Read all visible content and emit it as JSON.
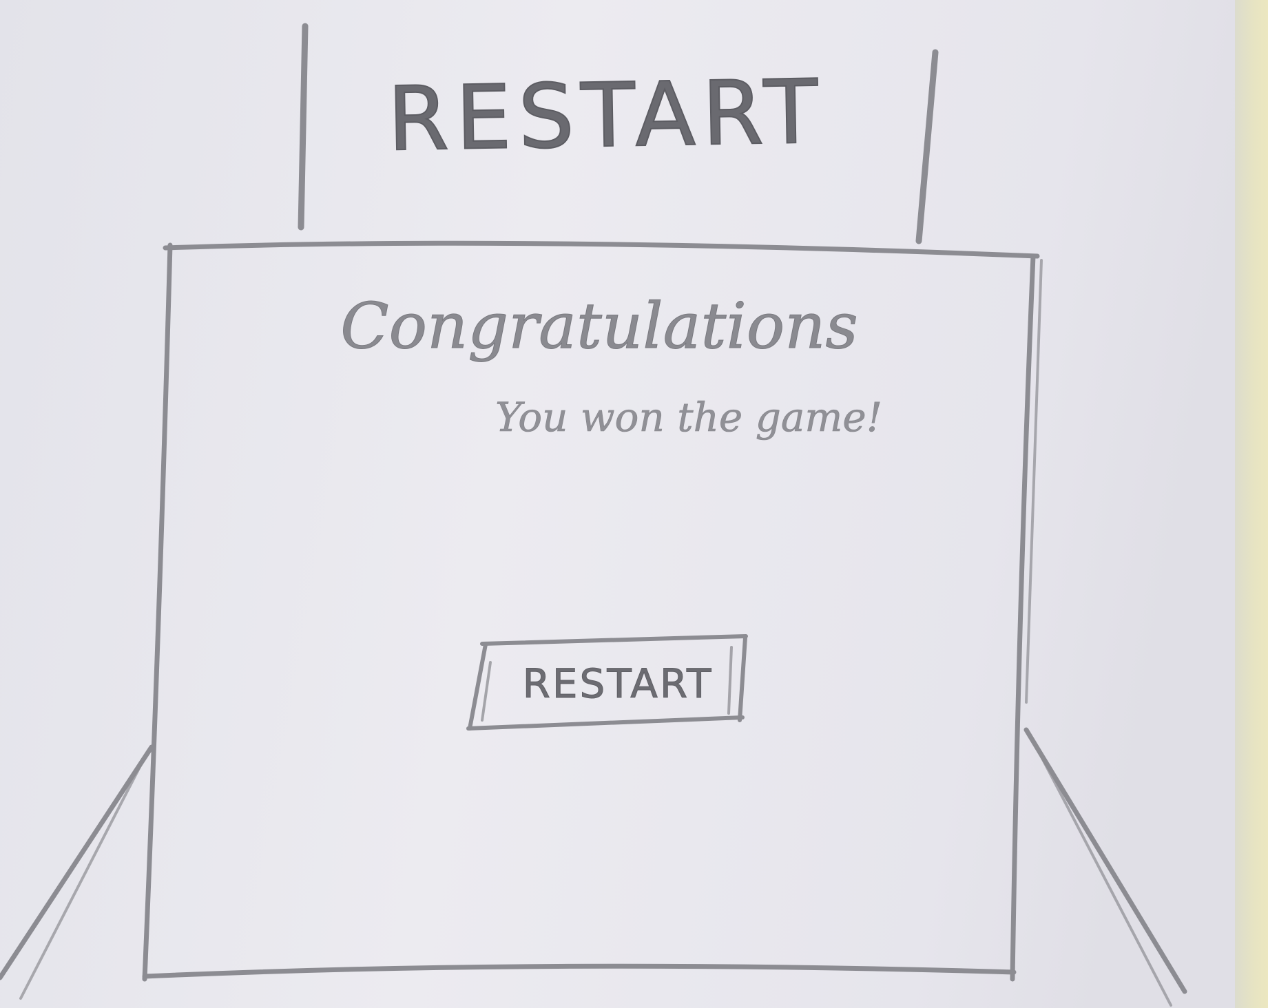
{
  "header": {
    "restart_label": "RESTART"
  },
  "dialog": {
    "title": "Congratulations",
    "message": "You won the game!",
    "restart_button_label": "RESTART"
  },
  "colors": {
    "paper": "#e8e8ee",
    "pencil": "#8a8a90",
    "edge": "#e7e4c2"
  }
}
